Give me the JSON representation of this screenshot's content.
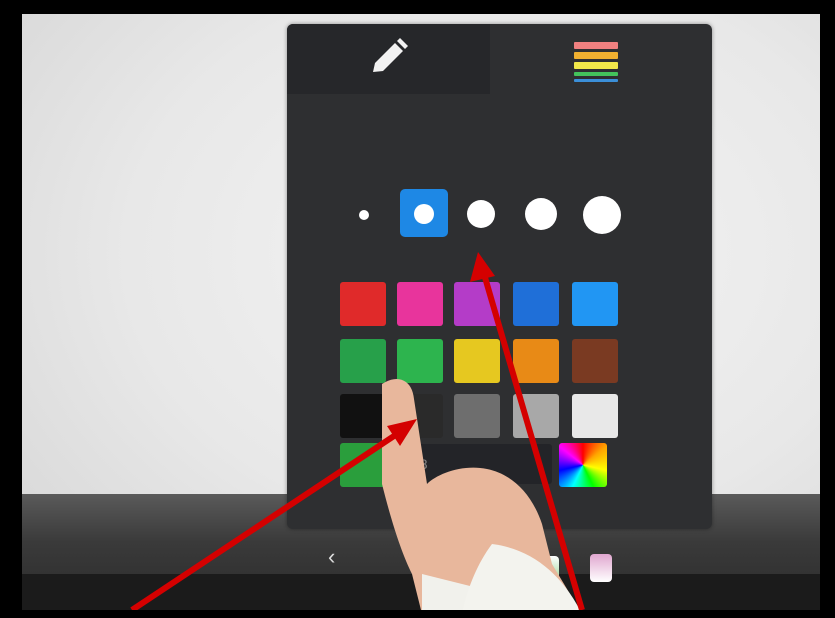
{
  "panel": {
    "tabs": [
      {
        "icon": "pencil-icon",
        "active": true
      },
      {
        "icon": "layers-icon",
        "active": false
      }
    ],
    "layer_colors": [
      "#f08080",
      "#f0b030",
      "#f2e84a",
      "#43c35b",
      "#3b8fd8"
    ],
    "pen_sizes": [
      {
        "size": 1,
        "selected": false
      },
      {
        "size": 2,
        "selected": true
      },
      {
        "size": 3,
        "selected": false
      },
      {
        "size": 4,
        "selected": false
      },
      {
        "size": 5,
        "selected": false
      }
    ],
    "selected_color": "#1e88e5",
    "colors": [
      [
        "#e02a2a",
        "#e8349c",
        "#b43cc8",
        "#1f6fd8",
        "#2196f3"
      ],
      [
        "#27a04a",
        "#2db44e",
        "#e6c820",
        "#e88a16",
        "#7a3a22"
      ],
      [
        "#111111",
        "#2a2a2a",
        "#6e6e6e",
        "#a8a8a8",
        "#e8e8e8"
      ]
    ],
    "custom_color": "#2a9e3c",
    "hex_value": "88",
    "color_picker_icon": "rainbow-palette-icon"
  },
  "annotations": {
    "arrow_color": "#d40000"
  }
}
